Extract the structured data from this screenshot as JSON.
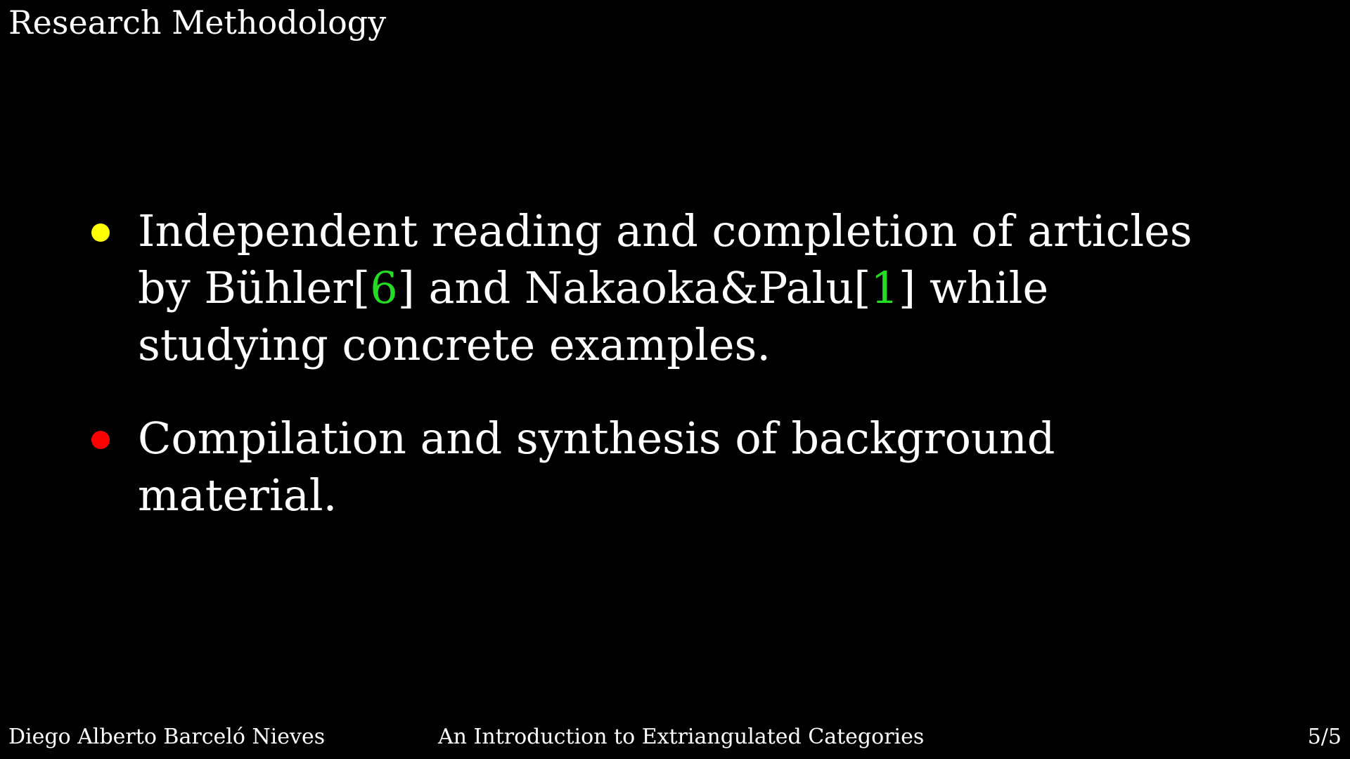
{
  "slide": {
    "title": "Research Methodology"
  },
  "bullets": [
    {
      "color": "#ffff00",
      "text_1": "Independent reading and completion of articles by Bühler[",
      "cite_1": "6",
      "text_2": "] and Nakaoka&Palu[",
      "cite_2": "1",
      "text_3": "] while studying concrete examples."
    },
    {
      "color": "#ff0000",
      "text": "Compilation and synthesis of background material."
    }
  ],
  "footer": {
    "author": "Diego Alberto Barceló Nieves",
    "title": "An Introduction to Extriangulated Categories",
    "page": "5/5"
  }
}
